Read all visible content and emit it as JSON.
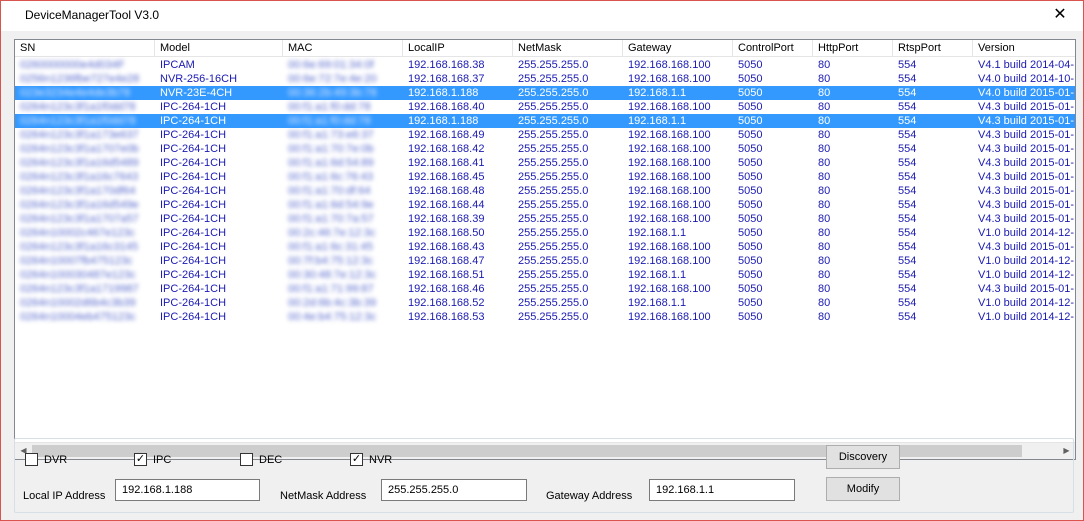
{
  "window": {
    "title": "DeviceManagerTool V3.0",
    "close_glyph": "✕"
  },
  "columns": [
    "SN",
    "Model",
    "MAC",
    "LocalIP",
    "NetMask",
    "Gateway",
    "ControlPort",
    "HttpPort",
    "RtspPort",
    "Version"
  ],
  "rows": [
    {
      "selected": false,
      "cells": [
        "0260000000e4d034F",
        "IPCAM",
        "00:6e:69:01:34:0f",
        "192.168.168.38",
        "255.255.255.0",
        "192.168.168.100",
        "5050",
        "80",
        "554",
        "V4.1 build 2014-04-"
      ]
    },
    {
      "selected": false,
      "cells": [
        "0256n1236fbe727e4e28",
        "NVR-256-16CH",
        "00:6e:72:7e:4e:20",
        "192.168.168.37",
        "255.255.255.0",
        "192.168.168.100",
        "5050",
        "80",
        "554",
        "V4.0 build 2014-10-"
      ]
    },
    {
      "selected": true,
      "cells": [
        "023e3234e4e4de3b78",
        "NVR-23E-4CH",
        "00:36:2b:49:3b:78",
        "192.168.1.188",
        "255.255.255.0",
        "192.168.1.1",
        "5050",
        "80",
        "554",
        "V4.0 build 2015-01-"
      ]
    },
    {
      "selected": false,
      "cells": [
        "0264n123c3f1a1f0dd78",
        "IPC-264-1CH",
        "00:f1:a1:f0:dd:78",
        "192.168.168.40",
        "255.255.255.0",
        "192.168.168.100",
        "5050",
        "80",
        "554",
        "V4.3 build 2015-01-"
      ]
    },
    {
      "selected": true,
      "cells": [
        "0264n123c3f1a1f0dd78",
        "IPC-264-1CH",
        "00:f1:a1:f0:dd:78",
        "192.168.1.188",
        "255.255.255.0",
        "192.168.1.1",
        "5050",
        "80",
        "554",
        "V4.3 build 2015-01-"
      ]
    },
    {
      "selected": false,
      "cells": [
        "0264n123c3f1a173e637",
        "IPC-264-1CH",
        "00:f1:a1:73:e6:37",
        "192.168.168.49",
        "255.255.255.0",
        "192.168.168.100",
        "5050",
        "80",
        "554",
        "V4.3 build 2015-01-"
      ]
    },
    {
      "selected": false,
      "cells": [
        "0264n123c3f1a1707e0b",
        "IPC-264-1CH",
        "00:f1:a1:70:7e:0b",
        "192.168.168.42",
        "255.255.255.0",
        "192.168.168.100",
        "5050",
        "80",
        "554",
        "V4.3 build 2015-01-"
      ]
    },
    {
      "selected": false,
      "cells": [
        "0264n123c3f1a16d5489",
        "IPC-264-1CH",
        "00:f1:a1:6d:54:89",
        "192.168.168.41",
        "255.255.255.0",
        "192.168.168.100",
        "5050",
        "80",
        "554",
        "V4.3 build 2015-01-"
      ]
    },
    {
      "selected": false,
      "cells": [
        "0264n123c3f1a16c7643",
        "IPC-264-1CH",
        "00:f1:a1:6c:76:43",
        "192.168.168.45",
        "255.255.255.0",
        "192.168.168.100",
        "5050",
        "80",
        "554",
        "V4.3 build 2015-01-"
      ]
    },
    {
      "selected": false,
      "cells": [
        "0264n123c3f1a170df64",
        "IPC-264-1CH",
        "00:f1:a1:70:df:64",
        "192.168.168.48",
        "255.255.255.0",
        "192.168.168.100",
        "5050",
        "80",
        "554",
        "V4.3 build 2015-01-"
      ]
    },
    {
      "selected": false,
      "cells": [
        "0264n123c3f1a16d549e",
        "IPC-264-1CH",
        "00:f1:a1:6d:54:9e",
        "192.168.168.44",
        "255.255.255.0",
        "192.168.168.100",
        "5050",
        "80",
        "554",
        "V4.3 build 2015-01-"
      ]
    },
    {
      "selected": false,
      "cells": [
        "0264n123c3f1a1707a57",
        "IPC-264-1CH",
        "00:f1:a1:70:7a:57",
        "192.168.168.39",
        "255.255.255.0",
        "192.168.168.100",
        "5050",
        "80",
        "554",
        "V4.3 build 2015-01-"
      ]
    },
    {
      "selected": false,
      "cells": [
        "0264n10002c467e123c",
        "IPC-264-1CH",
        "00:2c:46:7e:12:3c",
        "192.168.168.50",
        "255.255.255.0",
        "192.168.1.1",
        "5050",
        "80",
        "554",
        "V1.0 build 2014-12-"
      ]
    },
    {
      "selected": false,
      "cells": [
        "0264n123c3f1a16c3145",
        "IPC-264-1CH",
        "00:f1:a1:6c:31:45",
        "192.168.168.43",
        "255.255.255.0",
        "192.168.168.100",
        "5050",
        "80",
        "554",
        "V4.3 build 2015-01-"
      ]
    },
    {
      "selected": false,
      "cells": [
        "0264n10007fb475123c",
        "IPC-264-1CH",
        "00:7f:b4:75:12:3c",
        "192.168.168.47",
        "255.255.255.0",
        "192.168.168.100",
        "5050",
        "80",
        "554",
        "V1.0 build 2014-12-"
      ]
    },
    {
      "selected": false,
      "cells": [
        "0264n100030487e123c",
        "IPC-264-1CH",
        "00:30:48:7e:12:3c",
        "192.168.168.51",
        "255.255.255.0",
        "192.168.1.1",
        "5050",
        "80",
        "554",
        "V1.0 build 2014-12-"
      ]
    },
    {
      "selected": false,
      "cells": [
        "0264n123c3f1a1719987",
        "IPC-264-1CH",
        "00:f1:a1:71:99:87",
        "192.168.168.46",
        "255.255.255.0",
        "192.168.168.100",
        "5050",
        "80",
        "554",
        "V4.3 build 2015-01-"
      ]
    },
    {
      "selected": false,
      "cells": [
        "0264n10002d6b4c3b39",
        "IPC-264-1CH",
        "00:2d:6b:4c:3b:39",
        "192.168.168.52",
        "255.255.255.0",
        "192.168.1.1",
        "5050",
        "80",
        "554",
        "V1.0 build 2014-12-"
      ]
    },
    {
      "selected": false,
      "cells": [
        "0264n10004eb475123c",
        "IPC-264-1CH",
        "00:4e:b4:75:12:3c",
        "192.168.168.53",
        "255.255.255.0",
        "192.168.168.100",
        "5050",
        "80",
        "554",
        "V1.0 build 2014-12-"
      ]
    }
  ],
  "filters": [
    {
      "label": "DVR",
      "checked": false
    },
    {
      "label": "IPC",
      "checked": true
    },
    {
      "label": "DEC",
      "checked": false
    },
    {
      "label": "NVR",
      "checked": true
    }
  ],
  "form": {
    "local_ip_label": "Local IP Address",
    "local_ip_value": "192.168.1.188",
    "netmask_label": "NetMask Address",
    "netmask_value": "255.255.255.0",
    "gateway_label": "Gateway Address",
    "gateway_value": "192.168.1.1"
  },
  "buttons": {
    "discovery": "Discovery",
    "modify": "Modify"
  },
  "icons": {
    "scroll_left": "◀",
    "scroll_right": "▶",
    "check_mark": "✓"
  }
}
